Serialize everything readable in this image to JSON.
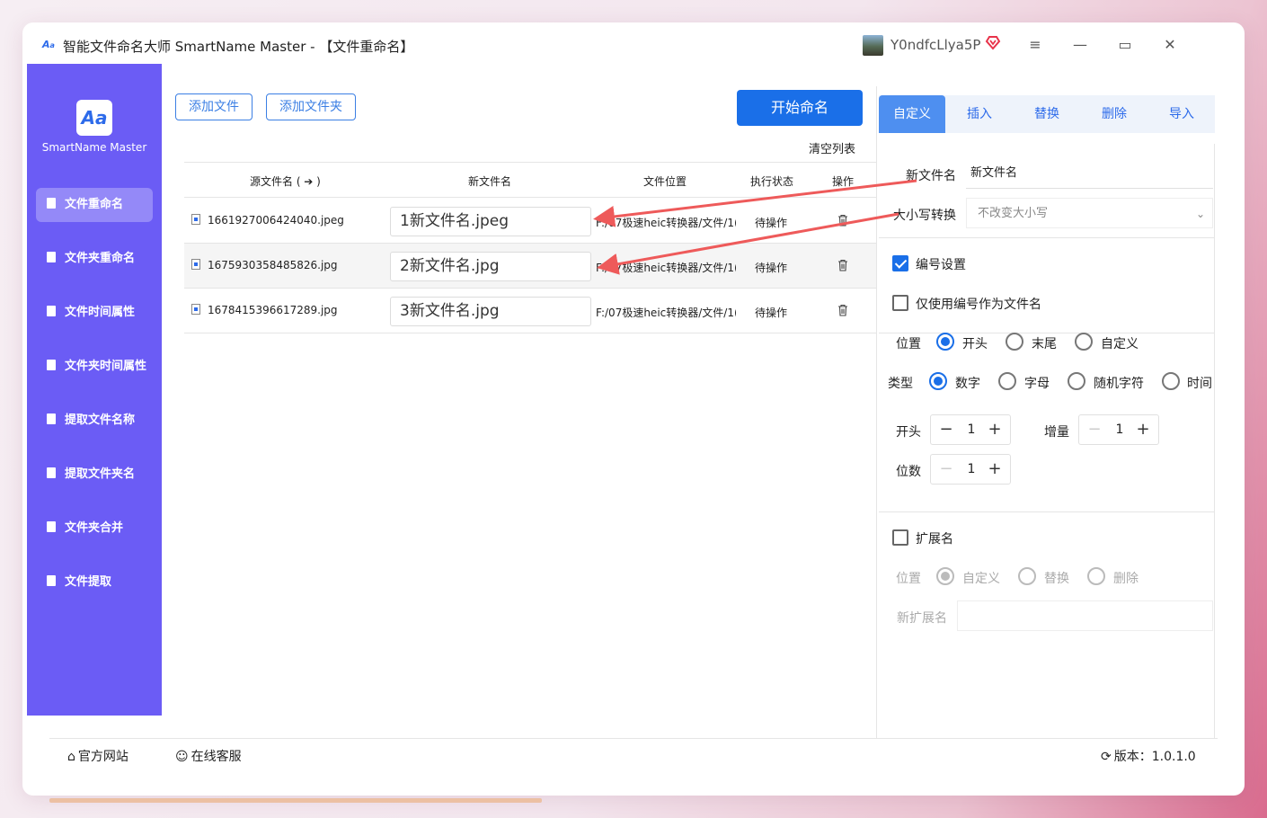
{
  "window": {
    "title": "智能文件命名大师 SmartName Master - 【文件重命名】"
  },
  "user": {
    "name": "Y0ndfcLlya5P"
  },
  "window_controls": {
    "menu": "≡",
    "minimize": "—",
    "maximize": "▭",
    "close": "✕"
  },
  "sidebar": {
    "logo_text": "Aa",
    "brand": "SmartName Master",
    "items": [
      {
        "label": "文件重命名",
        "active": true
      },
      {
        "label": "文件夹重命名",
        "active": false
      },
      {
        "label": "文件时间属性",
        "active": false
      },
      {
        "label": "文件夹时间属性",
        "active": false
      },
      {
        "label": "提取文件名称",
        "active": false
      },
      {
        "label": "提取文件夹名",
        "active": false
      },
      {
        "label": "文件夹合并",
        "active": false
      },
      {
        "label": "文件提取",
        "active": false
      }
    ]
  },
  "toolbar": {
    "add_file": "添加文件",
    "add_folder": "添加文件夹",
    "start_rename": "开始命名",
    "clear_list": "清空列表"
  },
  "table": {
    "headers": {
      "source": "源文件名 ( ➔ )",
      "new_name": "新文件名",
      "location": "文件位置",
      "status": "执行状态",
      "action": "操作"
    },
    "rows": [
      {
        "source": "1661927006424040.jpeg",
        "new_name": "1新文件名.jpeg",
        "location": "F:/07极速heic转换器/文件/1(",
        "status": "待操作"
      },
      {
        "source": "1675930358485826.jpg",
        "new_name": "2新文件名.jpg",
        "location": "F:/07极速heic转换器/文件/1(",
        "status": "待操作"
      },
      {
        "source": "1678415396617289.jpg",
        "new_name": "3新文件名.jpg",
        "location": "F:/07极速heic转换器/文件/1(",
        "status": "待操作"
      }
    ]
  },
  "tabs": [
    {
      "label": "自定义",
      "active": true
    },
    {
      "label": "插入",
      "active": false
    },
    {
      "label": "替换",
      "active": false
    },
    {
      "label": "删除",
      "active": false
    },
    {
      "label": "导入",
      "active": false
    }
  ],
  "settings": {
    "new_name_label": "新文件名",
    "new_name_value": "新文件名",
    "case_label": "大小写转换",
    "case_value": "不改变大小写",
    "numbering_label": "编号设置",
    "numbering_checked": true,
    "only_number_label": "仅使用编号作为文件名",
    "only_number_checked": false,
    "position_label": "位置",
    "position_options": [
      "开头",
      "末尾",
      "自定义"
    ],
    "position_selected": "开头",
    "type_label": "类型",
    "type_options": [
      "数字",
      "字母",
      "随机字符",
      "时间"
    ],
    "type_selected": "数字",
    "start_label": "开头",
    "start_value": "1",
    "increment_label": "增量",
    "increment_value": "1",
    "digits_label": "位数",
    "digits_value": "1",
    "ext_label": "扩展名",
    "ext_checked": false,
    "ext_position_label": "位置",
    "ext_options": [
      "自定义",
      "替换",
      "删除"
    ],
    "ext_selected": "自定义",
    "new_ext_label": "新扩展名",
    "new_ext_value": ""
  },
  "footer": {
    "website": "官方网站",
    "support": "在线客服",
    "version": "版本：1.0.1.0"
  },
  "colors": {
    "sidebar": "#6b5cf5",
    "primary": "#1a6fe8",
    "tab_active": "#4e8ff0",
    "arrow": "#ee5a5a"
  }
}
